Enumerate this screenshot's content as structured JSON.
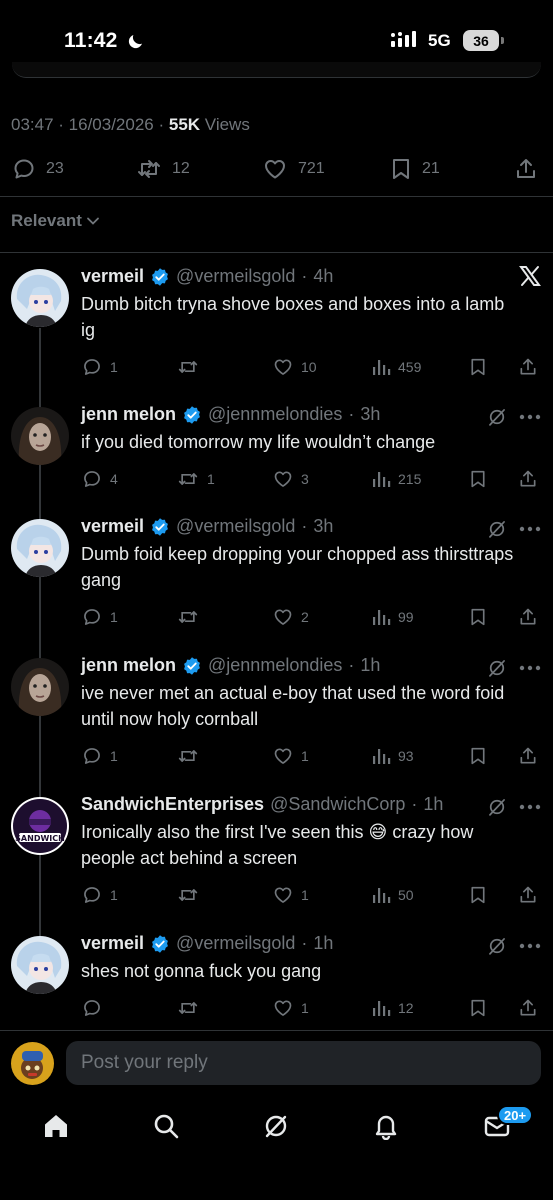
{
  "status_bar": {
    "time": "11:42",
    "network": "5G",
    "battery": "36"
  },
  "main_post": {
    "time": "03:47",
    "date": "16/03/2026",
    "views_count": "55K",
    "views_label": "Views",
    "stats": {
      "replies": "23",
      "reposts": "12",
      "likes": "721",
      "bookmarks": "21"
    }
  },
  "sort": {
    "label": "Relevant"
  },
  "replies": [
    {
      "name": "vermeil",
      "verified": true,
      "handle": "@vermeilsgold",
      "time": "4h",
      "text": "Dumb bitch tryna shove boxes and boxes into a lamb ig",
      "replies": "1",
      "reposts": "",
      "likes": "10",
      "views": "459",
      "corner_icon": "x-logo-icon"
    },
    {
      "name": "jenn melon",
      "verified": true,
      "handle": "@jennmelondies",
      "time": "3h",
      "text": "if you died tomorrow my life wouldn’t change",
      "replies": "4",
      "reposts": "1",
      "likes": "3",
      "views": "215",
      "corner_icon": "grok-icon"
    },
    {
      "name": "vermeil",
      "verified": true,
      "handle": "@vermeilsgold",
      "time": "3h",
      "text": "Dumb foid keep dropping your chopped ass thirsttraps gang",
      "replies": "1",
      "reposts": "",
      "likes": "2",
      "views": "99",
      "corner_icon": "grok-icon"
    },
    {
      "name": "jenn melon",
      "verified": true,
      "handle": "@jennmelondies",
      "time": "1h",
      "text": "ive never met an actual e-boy that used the word foid until now holy cornball",
      "replies": "1",
      "reposts": "",
      "likes": "1",
      "views": "93",
      "corner_icon": "grok-icon"
    },
    {
      "name": "SandwichEnterprises",
      "verified": false,
      "handle": "@SandwichCorp",
      "time": "1h",
      "text": "Ironically also the first I've seen this 😅 crazy how people act behind a screen",
      "replies": "1",
      "reposts": "",
      "likes": "1",
      "views": "50",
      "corner_icon": "grok-icon",
      "avatar_text": "SANDWICH"
    },
    {
      "name": "vermeil",
      "verified": true,
      "handle": "@vermeilsgold",
      "time": "1h",
      "text": "shes not gonna fuck you gang",
      "replies": "",
      "reposts": "",
      "likes": "1",
      "views": "12",
      "corner_icon": "grok-icon"
    }
  ],
  "compose": {
    "placeholder": "Post your reply"
  },
  "bottom_nav": {
    "messages_badge": "20+"
  },
  "colors": {
    "accent": "#1d9bf0",
    "muted": "#71767b",
    "background": "#000000",
    "text": "#e7e9ea"
  }
}
